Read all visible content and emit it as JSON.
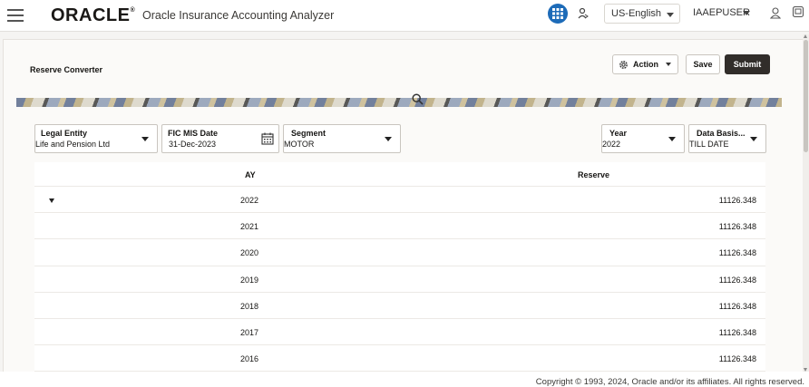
{
  "header": {
    "logo_text": "ORACLE",
    "logo_reg": "®",
    "app_name": "Oracle Insurance Accounting Analyzer",
    "language": "US-English",
    "user": "IAAEPUSER"
  },
  "page": {
    "title": "Reserve Converter"
  },
  "toolbar": {
    "action_label": "Action",
    "save_label": "Save",
    "submit_label": "Submit"
  },
  "filters": {
    "legal_entity": {
      "label": "Legal Entity",
      "value": "Life and Pension Ltd"
    },
    "fic_mis_date": {
      "label": "FIC MIS Date",
      "value": "31-Dec-2023"
    },
    "segment": {
      "label": "Segment",
      "value": "MOTOR"
    },
    "year": {
      "label": "Year",
      "value": "2022"
    },
    "data_basis": {
      "label": "Data Basis...",
      "value": "TILL DATE"
    }
  },
  "table": {
    "columns": {
      "ay": "AY",
      "reserve": "Reserve"
    },
    "rows": [
      {
        "ay": "2022",
        "reserve": "11126.348"
      },
      {
        "ay": "2021",
        "reserve": "11126.348"
      },
      {
        "ay": "2020",
        "reserve": "11126.348"
      },
      {
        "ay": "2019",
        "reserve": "11126.348"
      },
      {
        "ay": "2018",
        "reserve": "11126.348"
      },
      {
        "ay": "2017",
        "reserve": "11126.348"
      },
      {
        "ay": "2016",
        "reserve": "11126.348"
      }
    ]
  },
  "footer": {
    "copyright": "Copyright © 1993, 2024, Oracle and/or its affiliates. All rights reserved."
  },
  "icons": {
    "menu": "hamburger-menu-icon",
    "apps": "grid-apps-icon",
    "user_switch": "user-switch-icon",
    "person": "person-icon",
    "monitor": "monitor-icon",
    "gear": "gear-icon",
    "calendar": "calendar-icon",
    "search": "search-icon"
  },
  "colors": {
    "accent_blue": "#1d6bb8",
    "submit_bg": "#312d2a"
  }
}
